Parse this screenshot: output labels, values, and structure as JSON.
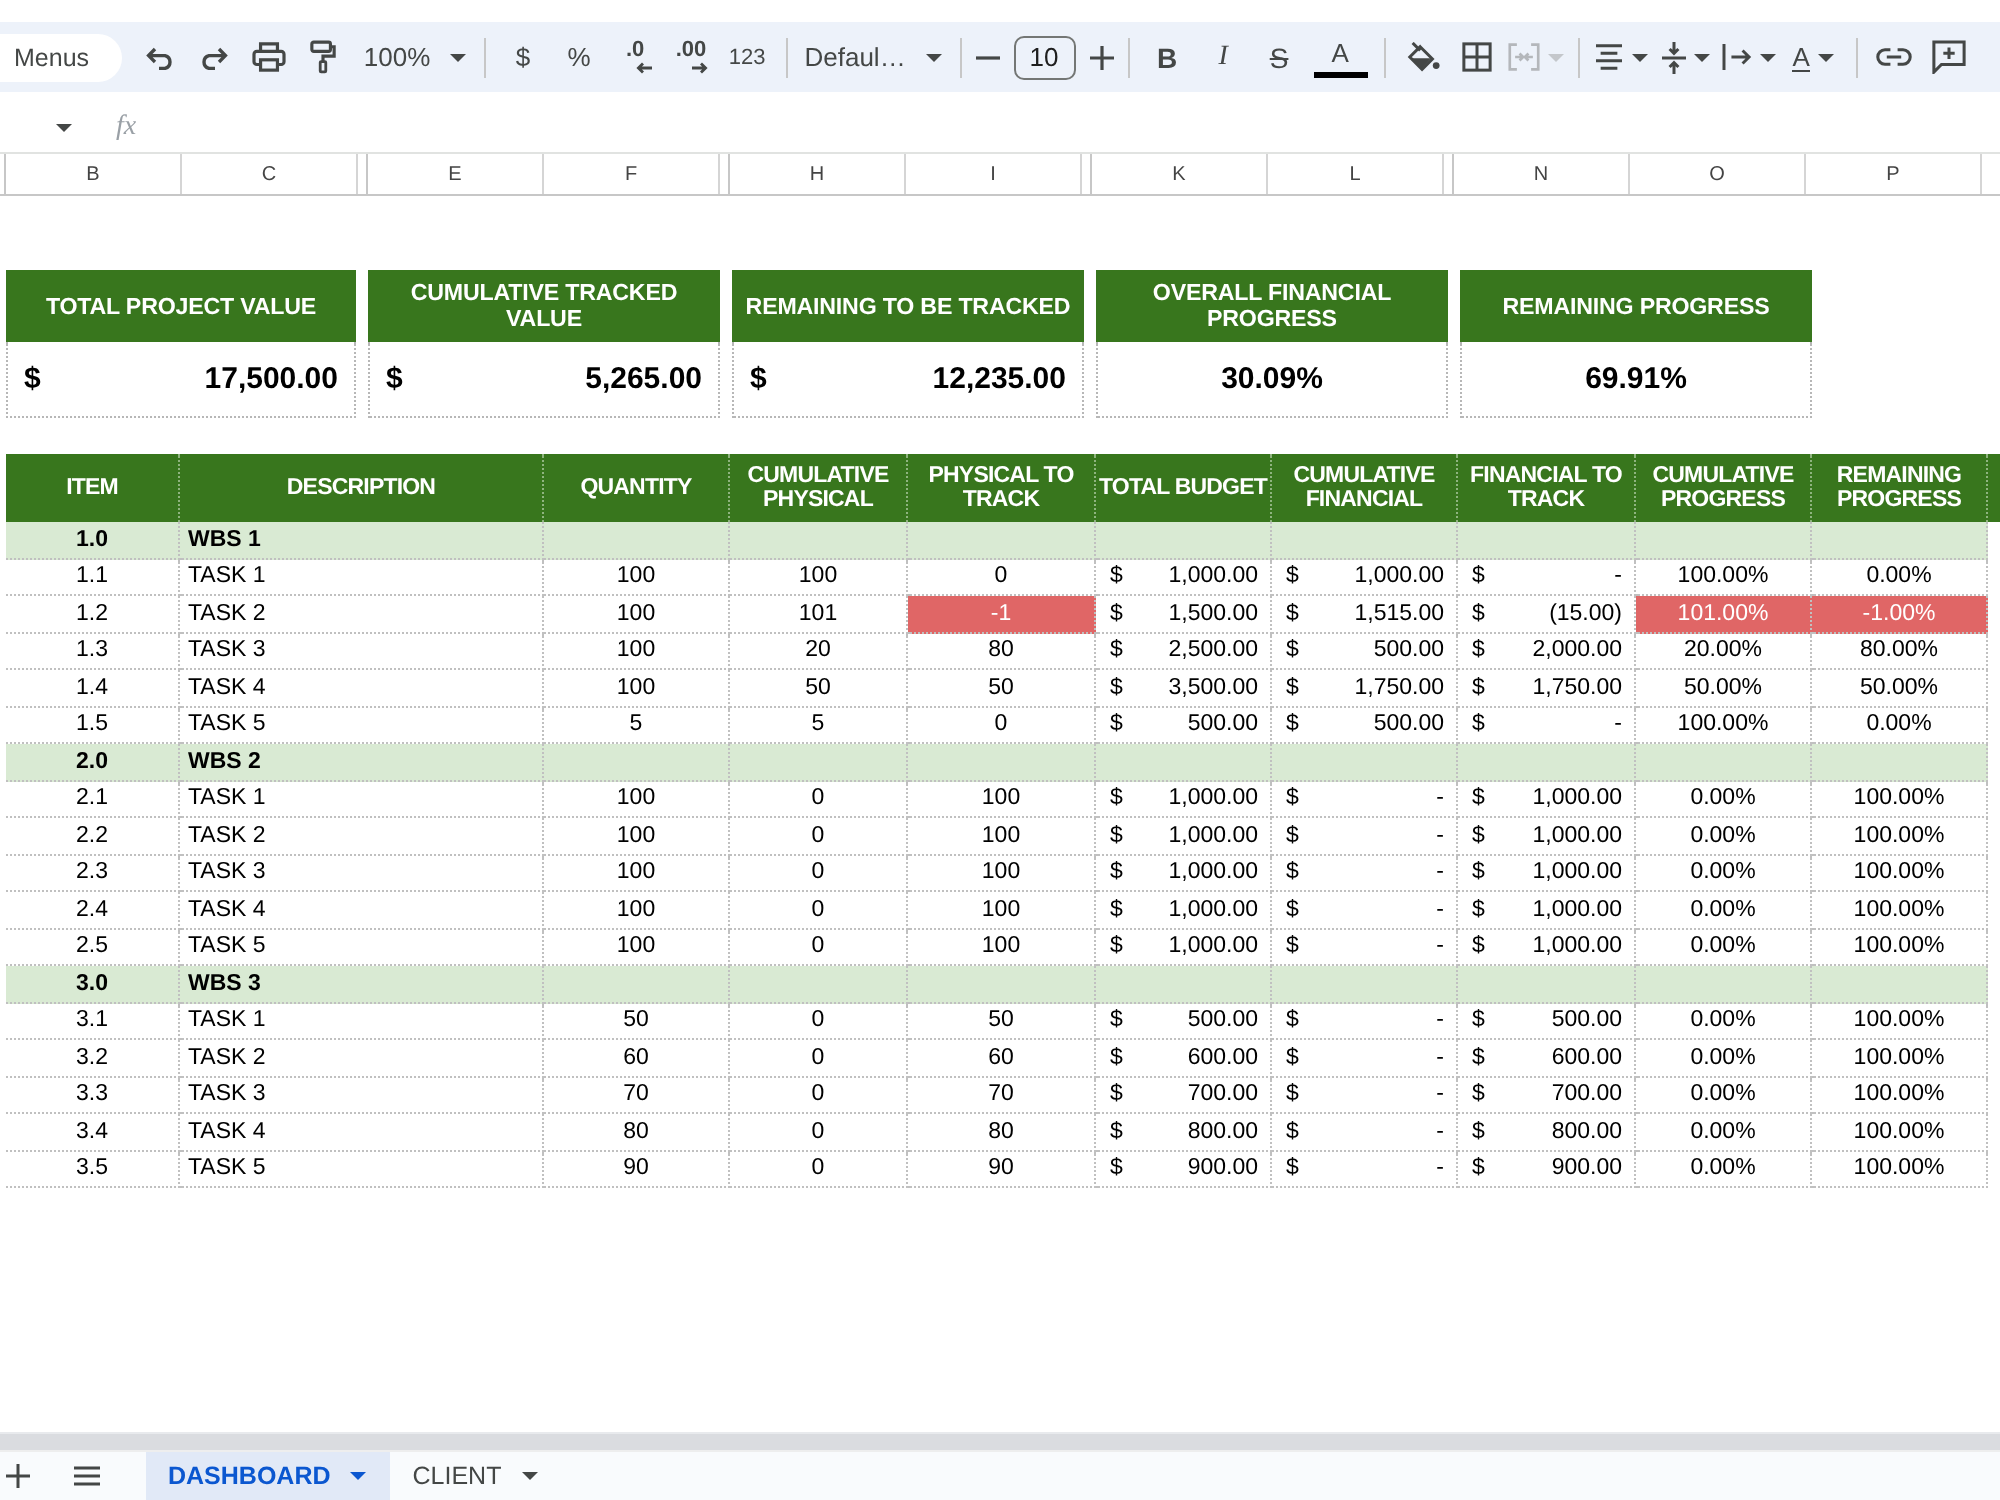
{
  "toolbar": {
    "menus": "Menus",
    "zoom": "100%",
    "currency": "$",
    "percent": "%",
    "decrease_decimal": ".0",
    "increase_decimal": ".00",
    "number_format": "123",
    "font": "Defaul…",
    "font_size": "10",
    "bold": "B",
    "italic": "I",
    "strikethrough": "S",
    "text_color": "A",
    "merge_cells": {
      "disabled": true
    },
    "text_rotation": "A"
  },
  "formula_bar": {
    "function_label": "fx"
  },
  "column_headers": [
    "B",
    "C",
    "E",
    "F",
    "H",
    "I",
    "K",
    "L",
    "N",
    "O",
    "P"
  ],
  "summary_cards": [
    {
      "label": "TOTAL PROJECT VALUE",
      "kind": "currency",
      "symbol": "$",
      "value": "17,500.00"
    },
    {
      "label": "CUMULATIVE TRACKED VALUE",
      "kind": "currency",
      "symbol": "$",
      "value": "5,265.00"
    },
    {
      "label": "REMAINING TO BE TRACKED",
      "kind": "currency",
      "symbol": "$",
      "value": "12,235.00"
    },
    {
      "label": "OVERALL FINANCIAL PROGRESS",
      "kind": "percent",
      "value": "30.09%"
    },
    {
      "label": "REMAINING PROGRESS",
      "kind": "percent",
      "value": "69.91%"
    }
  ],
  "table": {
    "columns": [
      "ITEM",
      "DESCRIPTION",
      "QUANTITY",
      "CUMULATIVE PHYSICAL",
      "PHYSICAL TO TRACK",
      "TOTAL BUDGET",
      "CUMULATIVE FINANCIAL",
      "FINANCIAL TO TRACK",
      "CUMULATIVE PROGRESS",
      "REMAINING PROGRESS"
    ],
    "rows": [
      {
        "kind": "group",
        "item": "1.0",
        "description": "WBS 1"
      },
      {
        "kind": "task",
        "item": "1.1",
        "description": "TASK 1",
        "quantity": "100",
        "cumulative_physical": "100",
        "physical_to_track": {
          "text": "0",
          "highlighted": false
        },
        "total_budget": {
          "symbol": "$",
          "amount": "1,000.00"
        },
        "cumulative_financial": {
          "symbol": "$",
          "amount": "1,000.00"
        },
        "financial_to_track": {
          "symbol": "$",
          "amount": "-"
        },
        "cumulative_progress": {
          "text": "100.00%",
          "highlighted": false
        },
        "remaining_progress": {
          "text": "0.00%",
          "highlighted": false
        }
      },
      {
        "kind": "task",
        "item": "1.2",
        "description": "TASK 2",
        "quantity": "100",
        "cumulative_physical": "101",
        "physical_to_track": {
          "text": "-1",
          "highlighted": true
        },
        "total_budget": {
          "symbol": "$",
          "amount": "1,500.00"
        },
        "cumulative_financial": {
          "symbol": "$",
          "amount": "1,515.00"
        },
        "financial_to_track": {
          "symbol": "$",
          "amount": "(15.00)"
        },
        "cumulative_progress": {
          "text": "101.00%",
          "highlighted": true
        },
        "remaining_progress": {
          "text": "-1.00%",
          "highlighted": true
        }
      },
      {
        "kind": "task",
        "item": "1.3",
        "description": "TASK 3",
        "quantity": "100",
        "cumulative_physical": "20",
        "physical_to_track": {
          "text": "80",
          "highlighted": false
        },
        "total_budget": {
          "symbol": "$",
          "amount": "2,500.00"
        },
        "cumulative_financial": {
          "symbol": "$",
          "amount": "500.00"
        },
        "financial_to_track": {
          "symbol": "$",
          "amount": "2,000.00"
        },
        "cumulative_progress": {
          "text": "20.00%",
          "highlighted": false
        },
        "remaining_progress": {
          "text": "80.00%",
          "highlighted": false
        }
      },
      {
        "kind": "task",
        "item": "1.4",
        "description": "TASK 4",
        "quantity": "100",
        "cumulative_physical": "50",
        "physical_to_track": {
          "text": "50",
          "highlighted": false
        },
        "total_budget": {
          "symbol": "$",
          "amount": "3,500.00"
        },
        "cumulative_financial": {
          "symbol": "$",
          "amount": "1,750.00"
        },
        "financial_to_track": {
          "symbol": "$",
          "amount": "1,750.00"
        },
        "cumulative_progress": {
          "text": "50.00%",
          "highlighted": false
        },
        "remaining_progress": {
          "text": "50.00%",
          "highlighted": false
        }
      },
      {
        "kind": "task",
        "item": "1.5",
        "description": "TASK 5",
        "quantity": "5",
        "cumulative_physical": "5",
        "physical_to_track": {
          "text": "0",
          "highlighted": false
        },
        "total_budget": {
          "symbol": "$",
          "amount": "500.00"
        },
        "cumulative_financial": {
          "symbol": "$",
          "amount": "500.00"
        },
        "financial_to_track": {
          "symbol": "$",
          "amount": "-"
        },
        "cumulative_progress": {
          "text": "100.00%",
          "highlighted": false
        },
        "remaining_progress": {
          "text": "0.00%",
          "highlighted": false
        }
      },
      {
        "kind": "group",
        "item": "2.0",
        "description": "WBS 2"
      },
      {
        "kind": "task",
        "item": "2.1",
        "description": "TASK 1",
        "quantity": "100",
        "cumulative_physical": "0",
        "physical_to_track": {
          "text": "100",
          "highlighted": false
        },
        "total_budget": {
          "symbol": "$",
          "amount": "1,000.00"
        },
        "cumulative_financial": {
          "symbol": "$",
          "amount": "-"
        },
        "financial_to_track": {
          "symbol": "$",
          "amount": "1,000.00"
        },
        "cumulative_progress": {
          "text": "0.00%",
          "highlighted": false
        },
        "remaining_progress": {
          "text": "100.00%",
          "highlighted": false
        }
      },
      {
        "kind": "task",
        "item": "2.2",
        "description": "TASK 2",
        "quantity": "100",
        "cumulative_physical": "0",
        "physical_to_track": {
          "text": "100",
          "highlighted": false
        },
        "total_budget": {
          "symbol": "$",
          "amount": "1,000.00"
        },
        "cumulative_financial": {
          "symbol": "$",
          "amount": "-"
        },
        "financial_to_track": {
          "symbol": "$",
          "amount": "1,000.00"
        },
        "cumulative_progress": {
          "text": "0.00%",
          "highlighted": false
        },
        "remaining_progress": {
          "text": "100.00%",
          "highlighted": false
        }
      },
      {
        "kind": "task",
        "item": "2.3",
        "description": "TASK 3",
        "quantity": "100",
        "cumulative_physical": "0",
        "physical_to_track": {
          "text": "100",
          "highlighted": false
        },
        "total_budget": {
          "symbol": "$",
          "amount": "1,000.00"
        },
        "cumulative_financial": {
          "symbol": "$",
          "amount": "-"
        },
        "financial_to_track": {
          "symbol": "$",
          "amount": "1,000.00"
        },
        "cumulative_progress": {
          "text": "0.00%",
          "highlighted": false
        },
        "remaining_progress": {
          "text": "100.00%",
          "highlighted": false
        }
      },
      {
        "kind": "task",
        "item": "2.4",
        "description": "TASK 4",
        "quantity": "100",
        "cumulative_physical": "0",
        "physical_to_track": {
          "text": "100",
          "highlighted": false
        },
        "total_budget": {
          "symbol": "$",
          "amount": "1,000.00"
        },
        "cumulative_financial": {
          "symbol": "$",
          "amount": "-"
        },
        "financial_to_track": {
          "symbol": "$",
          "amount": "1,000.00"
        },
        "cumulative_progress": {
          "text": "0.00%",
          "highlighted": false
        },
        "remaining_progress": {
          "text": "100.00%",
          "highlighted": false
        }
      },
      {
        "kind": "task",
        "item": "2.5",
        "description": "TASK 5",
        "quantity": "100",
        "cumulative_physical": "0",
        "physical_to_track": {
          "text": "100",
          "highlighted": false
        },
        "total_budget": {
          "symbol": "$",
          "amount": "1,000.00"
        },
        "cumulative_financial": {
          "symbol": "$",
          "amount": "-"
        },
        "financial_to_track": {
          "symbol": "$",
          "amount": "1,000.00"
        },
        "cumulative_progress": {
          "text": "0.00%",
          "highlighted": false
        },
        "remaining_progress": {
          "text": "100.00%",
          "highlighted": false
        }
      },
      {
        "kind": "group",
        "item": "3.0",
        "description": "WBS 3"
      },
      {
        "kind": "task",
        "item": "3.1",
        "description": "TASK 1",
        "quantity": "50",
        "cumulative_physical": "0",
        "physical_to_track": {
          "text": "50",
          "highlighted": false
        },
        "total_budget": {
          "symbol": "$",
          "amount": "500.00"
        },
        "cumulative_financial": {
          "symbol": "$",
          "amount": "-"
        },
        "financial_to_track": {
          "symbol": "$",
          "amount": "500.00"
        },
        "cumulative_progress": {
          "text": "0.00%",
          "highlighted": false
        },
        "remaining_progress": {
          "text": "100.00%",
          "highlighted": false
        }
      },
      {
        "kind": "task",
        "item": "3.2",
        "description": "TASK 2",
        "quantity": "60",
        "cumulative_physical": "0",
        "physical_to_track": {
          "text": "60",
          "highlighted": false
        },
        "total_budget": {
          "symbol": "$",
          "amount": "600.00"
        },
        "cumulative_financial": {
          "symbol": "$",
          "amount": "-"
        },
        "financial_to_track": {
          "symbol": "$",
          "amount": "600.00"
        },
        "cumulative_progress": {
          "text": "0.00%",
          "highlighted": false
        },
        "remaining_progress": {
          "text": "100.00%",
          "highlighted": false
        }
      },
      {
        "kind": "task",
        "item": "3.3",
        "description": "TASK 3",
        "quantity": "70",
        "cumulative_physical": "0",
        "physical_to_track": {
          "text": "70",
          "highlighted": false
        },
        "total_budget": {
          "symbol": "$",
          "amount": "700.00"
        },
        "cumulative_financial": {
          "symbol": "$",
          "amount": "-"
        },
        "financial_to_track": {
          "symbol": "$",
          "amount": "700.00"
        },
        "cumulative_progress": {
          "text": "0.00%",
          "highlighted": false
        },
        "remaining_progress": {
          "text": "100.00%",
          "highlighted": false
        }
      },
      {
        "kind": "task",
        "item": "3.4",
        "description": "TASK 4",
        "quantity": "80",
        "cumulative_physical": "0",
        "physical_to_track": {
          "text": "80",
          "highlighted": false
        },
        "total_budget": {
          "symbol": "$",
          "amount": "800.00"
        },
        "cumulative_financial": {
          "symbol": "$",
          "amount": "-"
        },
        "financial_to_track": {
          "symbol": "$",
          "amount": "800.00"
        },
        "cumulative_progress": {
          "text": "0.00%",
          "highlighted": false
        },
        "remaining_progress": {
          "text": "100.00%",
          "highlighted": false
        }
      },
      {
        "kind": "task",
        "item": "3.5",
        "description": "TASK 5",
        "quantity": "90",
        "cumulative_physical": "0",
        "physical_to_track": {
          "text": "90",
          "highlighted": false
        },
        "total_budget": {
          "symbol": "$",
          "amount": "900.00"
        },
        "cumulative_financial": {
          "symbol": "$",
          "amount": "-"
        },
        "financial_to_track": {
          "symbol": "$",
          "amount": "900.00"
        },
        "cumulative_progress": {
          "text": "0.00%",
          "highlighted": false
        },
        "remaining_progress": {
          "text": "100.00%",
          "highlighted": false
        }
      }
    ]
  },
  "sheet_tabs": [
    {
      "label": "DASHBOARD",
      "selected": true
    },
    {
      "label": "CLIENT",
      "selected": false
    }
  ]
}
